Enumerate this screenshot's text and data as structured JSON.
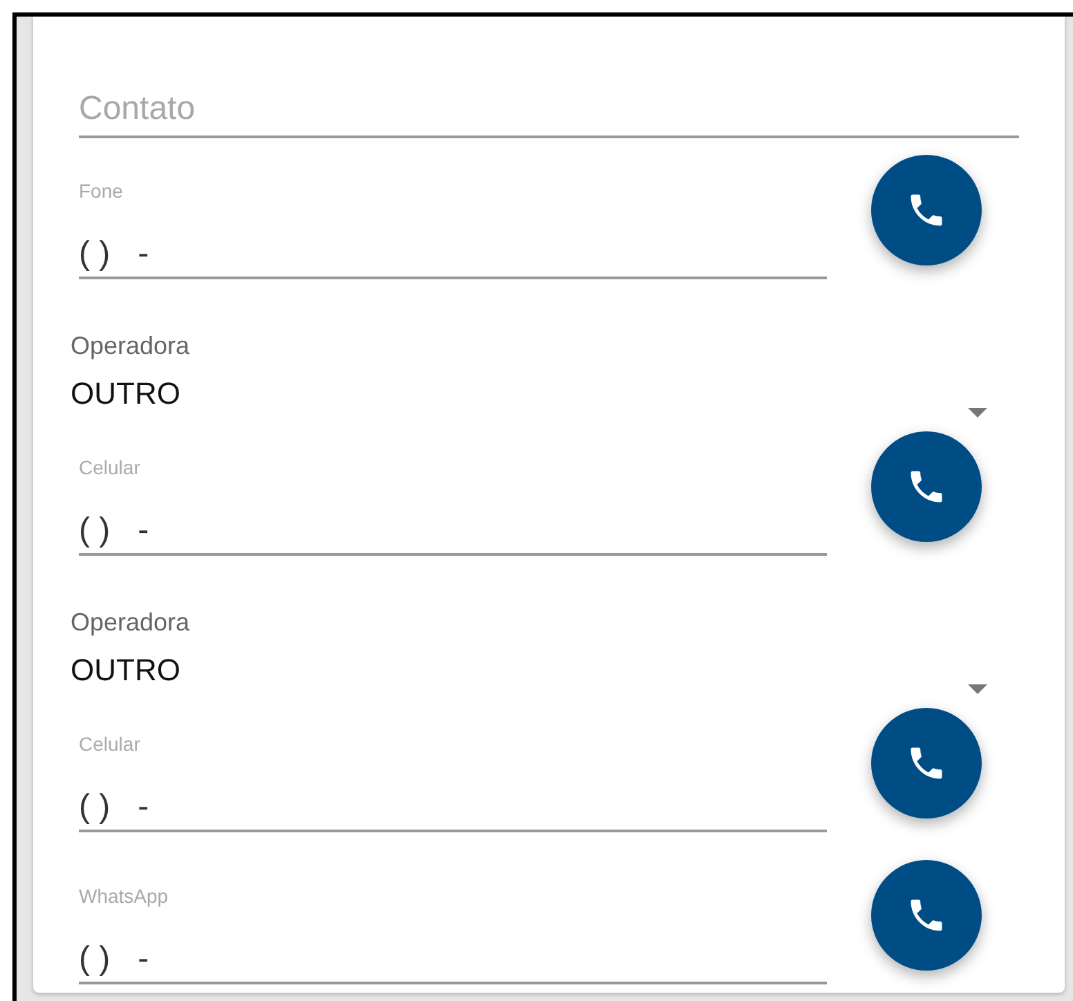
{
  "contact": {
    "placeholder": "Contato"
  },
  "fields": [
    {
      "kind": "phone",
      "label": "Fone",
      "value": "( )   -"
    },
    {
      "kind": "select",
      "label": "Operadora",
      "value": "OUTRO"
    },
    {
      "kind": "phone",
      "label": "Celular",
      "value": "( )   -"
    },
    {
      "kind": "select",
      "label": "Operadora",
      "value": "OUTRO"
    },
    {
      "kind": "phone",
      "label": "Celular",
      "value": "( )   -"
    },
    {
      "kind": "phone",
      "label": "WhatsApp",
      "value": "( )   -"
    }
  ]
}
